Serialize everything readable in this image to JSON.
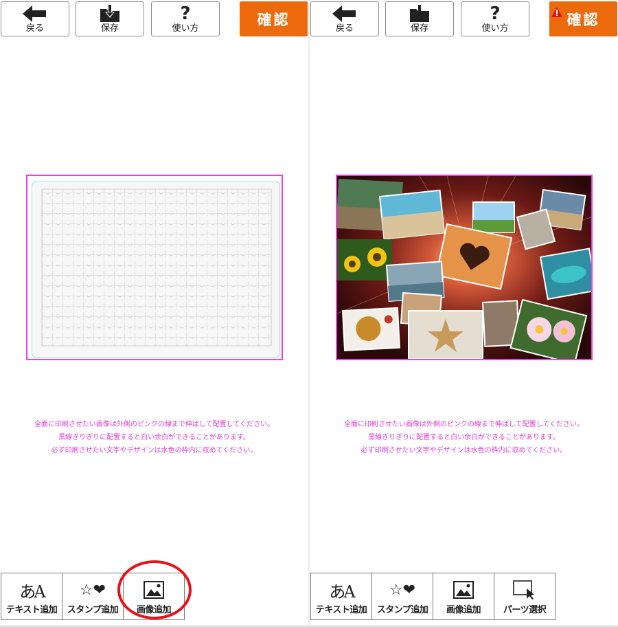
{
  "toolbar": {
    "back_label": "戻る",
    "save_label": "保存",
    "help_label": "使い方",
    "help_glyph": "?",
    "confirm_label": "確認"
  },
  "notice": {
    "lines": [
      "全面に印刷させたい画像は外側のピンクの線まで伸ばして配置してください。",
      "黒線ぎりぎりに配置すると白い余白ができることがあります。",
      "必ず印刷させたい文字やデザインは水色の枠内に収めてください。"
    ]
  },
  "bottom_bar": {
    "text_add_label": "テキスト追加",
    "stamp_add_label": "スタンプ追加",
    "image_add_label": "画像追加",
    "parts_select_label": "パーツ選択",
    "text_icon_glyph": "あA",
    "stamp_icon_glyph": "☆❤"
  },
  "colors": {
    "confirm_bg": "#ec6a0c",
    "bleed_line": "#ee3ee9",
    "safe_line": "#9adfea",
    "notice_text": "#e23ad9",
    "highlight": "#e8111a"
  },
  "icons": {
    "back": "arrow-left-icon",
    "save": "download-folder-icon",
    "help": "question-icon",
    "warning": "warning-icon",
    "text": "text-add-icon",
    "stamp": "star-heart-icon",
    "image": "image-icon",
    "parts": "cursor-select-icon"
  }
}
